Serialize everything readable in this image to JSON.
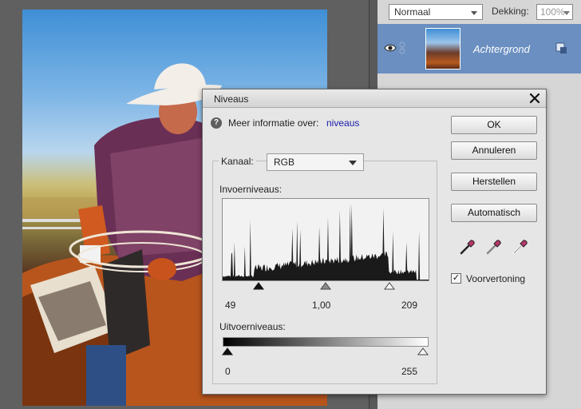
{
  "layers_panel": {
    "blend_mode": "Normaal",
    "opacity_label": "Dekking:",
    "opacity_value": "100%",
    "layer": {
      "name": "Achtergrond",
      "visible": true
    }
  },
  "dialog": {
    "title": "Niveaus",
    "info_text": "Meer informatie over:",
    "info_link": "niveaus",
    "channel_label": "Kanaal:",
    "channel_value": "RGB",
    "input_levels_label": "Invoerniveaus:",
    "input_black": "49",
    "input_gamma": "1,00",
    "input_white": "209",
    "output_levels_label": "Uitvoerniveaus:",
    "output_black": "0",
    "output_white": "255",
    "buttons": {
      "ok": "OK",
      "cancel": "Annuleren",
      "reset": "Herstellen",
      "auto": "Automatisch"
    },
    "preview_label": "Voorvertoning",
    "preview_checked": true
  },
  "colors": {
    "layer_selected": "#6a8fc0",
    "link": "#1a1aa8",
    "dialog_bg": "#e6e6e6"
  }
}
